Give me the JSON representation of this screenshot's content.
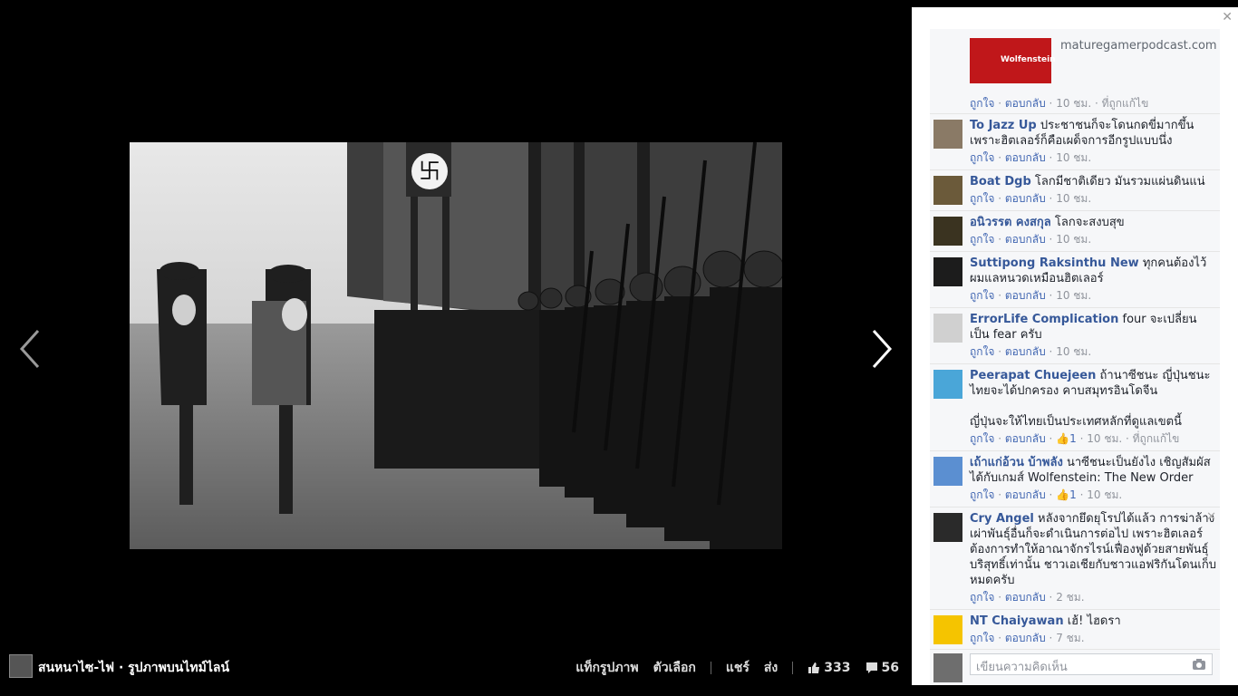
{
  "viewer": {
    "owner_name": "สนหนาไซ-ไฟ",
    "owner_suffix": "· รูปภาพบนไทม์ไลน์",
    "actions": {
      "tag": "แท็กรูปภาพ",
      "options": "ตัวเลือก",
      "share": "แชร์",
      "send": "ส่ง"
    },
    "likes": "333",
    "comments_count": "56"
  },
  "panel": {
    "link_preview": {
      "domain": "maturegamerpodcast.com",
      "thumb_text": "Wolfenstein"
    },
    "preview_meta": {
      "like": "ถูกใจ",
      "reply": "ตอบกลับ",
      "time": "10 ชม.",
      "edited": "ที่ถูกแก้ไข"
    },
    "comments": [
      {
        "name": "To Jazz Up",
        "text": "ประชาชนก็จะโดนกดขี่มากขึ้น เพราะฮิตเลอร์ก็คือเผด็จการอีกรูปแบบนึ่ง",
        "like": "ถูกใจ",
        "reply": "ตอบกลับ",
        "time": "10 ชม."
      },
      {
        "name": "Boat Dgb",
        "text": "โลกมีชาติเดียว มันรวมแผ่นดินแน่",
        "like": "ถูกใจ",
        "reply": "ตอบกลับ",
        "time": "10 ชม."
      },
      {
        "name": "อนิวรรต คงสกุล",
        "text": "โลกจะสงบสุข",
        "like": "ถูกใจ",
        "reply": "ตอบกลับ",
        "time": "10 ชม."
      },
      {
        "name": "Suttipong Raksinthu New",
        "text": "ทุกคนต้องไว้ผมแลหนวดเหมือนฮิตเลอร์",
        "like": "ถูกใจ",
        "reply": "ตอบกลับ",
        "time": "10 ชม."
      },
      {
        "name": "ErrorLife Complication",
        "text": "four จะเปลี่ยนเป็น fear ครับ",
        "like": "ถูกใจ",
        "reply": "ตอบกลับ",
        "time": "10 ชม."
      },
      {
        "name": "Peerapat Chuejeen",
        "text": "ถ้านาซีชนะ ญี่ปุ่นชนะ ไทยจะได้ปกครอง คาบสมุทรอินโดจีน",
        "text2": "ญี่ปุ่นจะให้ไทยเป็นประเทศหลักที่ดูแลเขตนี้",
        "like": "ถูกใจ",
        "reply": "ตอบกลับ",
        "likes": "1",
        "time": "10 ชม.",
        "edited": "ที่ถูกแก้ไข"
      },
      {
        "name": "เถ้าแก่อ้วน บ้าพลัง",
        "text": "นาซีชนะเป็นยังไง เชิญสัมผัสได้กับเกมส์ Wolfenstein: The New Order",
        "like": "ถูกใจ",
        "reply": "ตอบกลับ",
        "likes": "1",
        "time": "10 ชม."
      },
      {
        "name": "Cry Angel",
        "text": "หลังจากยึดยุโรปได้แล้ว การฆ่าล้างเผ่าพันธุ์อื่นก็จะดำเนินการต่อไป เพราะฮิตเลอร์ต้องการทำให้อาณาจักรไรน์เฟื่องฟูด้วยสายพันธุ์บริสุทธิ์เท่านั้น ชาวเอเชียกับชาวแอฟริกันโดนเก็บหมดครับ",
        "like": "ถูกใจ",
        "reply": "ตอบกลับ",
        "time": "2 ชม."
      },
      {
        "name": "NT Chaiyawan",
        "text": "เฮ้! ไฮดรา",
        "like": "ถูกใจ",
        "reply": "ตอบกลับ",
        "time": "7 ชม."
      }
    ],
    "reply_placeholder": "เขียนความคิดเห็น"
  },
  "colors": {
    "link": "#365899",
    "meta": "#90949c",
    "background": "#000000"
  }
}
